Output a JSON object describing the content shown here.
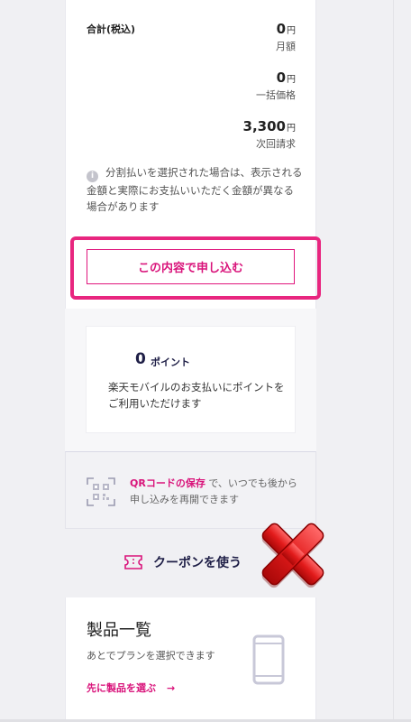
{
  "summary": {
    "total_label": "合計(税込)",
    "monthly": {
      "amount": "0",
      "yen": "円",
      "label": "月額"
    },
    "lump": {
      "amount": "0",
      "yen": "円",
      "label": "一括価格"
    },
    "next": {
      "amount": "3,300",
      "yen": "円",
      "label": "次回請求"
    },
    "notice_icon": "info-icon",
    "notice_text": "分割払いを選択された場合は、表示される金額と実際にお支払いいただく金額が異なる場合があります"
  },
  "apply_button_label": "この内容で申し込む",
  "points": {
    "value": "0",
    "unit": "ポイント",
    "description": "楽天モバイルのお支払いにポイントをご利用いただけます"
  },
  "qr": {
    "link_text": "QRコードの保存",
    "rest_text": "で、いつでも後から申し込みを再開できます"
  },
  "coupon": {
    "label": "クーポンを使う",
    "icon": "ticket-icon"
  },
  "overlay": {
    "icon": "red-x-icon"
  },
  "product": {
    "title": "製品一覧",
    "subtitle": "あとでプランを選択できます",
    "link_label": "先に製品を選ぶ",
    "link_arrow": "→",
    "icon": "smartphone-icon"
  },
  "colors": {
    "accent": "#d9147b",
    "highlight": "#e8267f",
    "navy": "#1e1e46"
  }
}
